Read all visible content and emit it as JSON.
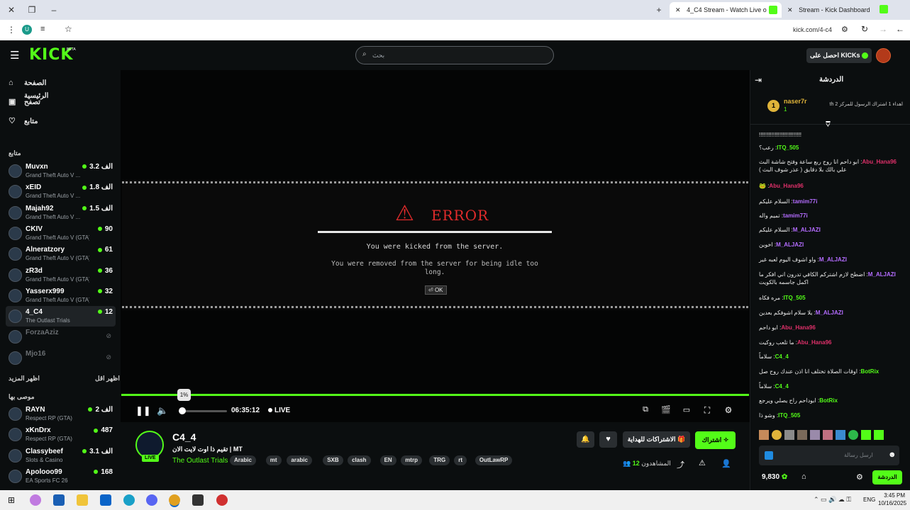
{
  "browser": {
    "tabs": [
      {
        "title": "4_C4 Stream - Watch Live o",
        "active": true
      },
      {
        "title": "Stream - Kick Dashboard",
        "active": false
      }
    ],
    "url": "kick.com/4-c4"
  },
  "header": {
    "logo": "KICK",
    "logo_sup": "BETA",
    "search_placeholder": "بحث",
    "get_kicks": "احصل على KICKs"
  },
  "sidebar": {
    "nav": [
      {
        "label": "الصفحة الرئيسية",
        "icon": "home-icon"
      },
      {
        "label": "تصفح",
        "icon": "browse-icon"
      },
      {
        "label": "متابع",
        "icon": "heart-icon"
      }
    ],
    "following_title": "متابع",
    "following": [
      {
        "name": "Muvxn",
        "game": "Grand Theft Auto V ...",
        "viewers": "3.2 الف",
        "live": true
      },
      {
        "name": "xEID",
        "game": "Grand Theft Auto V ...",
        "viewers": "1.8 الف",
        "live": true
      },
      {
        "name": "Majah92",
        "game": "Grand Theft Auto V ...",
        "viewers": "1.5 الف",
        "live": true
      },
      {
        "name": "CKIV",
        "game": "Grand Theft Auto V (GTA)",
        "viewers": "90",
        "live": true
      },
      {
        "name": "Alneratzory",
        "game": "Grand Theft Auto V (GTA)",
        "viewers": "61",
        "live": true
      },
      {
        "name": "zR3d",
        "game": "Grand Theft Auto V (GTA)",
        "viewers": "36",
        "live": true
      },
      {
        "name": "Yasserx999",
        "game": "Grand Theft Auto V (GTA)",
        "viewers": "32",
        "live": true
      },
      {
        "name": "4_C4",
        "game": "The Outlast Trials",
        "viewers": "12",
        "live": true,
        "selected": true
      },
      {
        "name": "ForzaAziz",
        "game": "",
        "viewers": "",
        "live": false
      },
      {
        "name": "Mjo16",
        "game": "",
        "viewers": "",
        "live": false
      }
    ],
    "show_more": "اظهر المزيد",
    "show_less": "اظهر اقل",
    "recommended_title": "موصى بها",
    "recommended": [
      {
        "name": "RAYN",
        "game": "Respect RP (GTA)",
        "viewers": "2 الف",
        "live": true
      },
      {
        "name": "xKnDrx",
        "game": "Respect RP (GTA)",
        "viewers": "487",
        "live": true
      },
      {
        "name": "Classybeef",
        "game": "Slots & Casino",
        "viewers": "3.1 الف",
        "live": true
      },
      {
        "name": "Apolooo99",
        "game": "EA Sports FC 26",
        "viewers": "168",
        "live": true
      }
    ]
  },
  "player": {
    "error_title": "ERROR",
    "error_line1": "You were kicked from the server.",
    "error_line2": "You were removed from the server for being idle too long.",
    "ok_label": "OK",
    "volume_tooltip": "1%",
    "volume_level": 0.01,
    "time": "06:35:12",
    "live_label": "LIVE",
    "colors": {
      "accent": "#53fc18",
      "error": "#e02b2b"
    }
  },
  "stream": {
    "channel": "C4_4",
    "title": "MT | تقيم ذا اوت لايت الان",
    "category": "The Outlast Trials",
    "tags": [
      "Arabic",
      "mt",
      "arabic",
      "SXB",
      "clash",
      "EN",
      "mtrp",
      "TRG",
      "rt",
      "OutLawRP"
    ],
    "subscribe": "اشتراك",
    "gift_subs": "الاشتراكات للهداية",
    "viewers_label": "المشاهدون",
    "viewers": "12",
    "live_badge": "LIVE"
  },
  "chat": {
    "title": "الدردشة",
    "pinned_user": "naser7r",
    "pinned_count": "1",
    "pinned_text": "اهداء 1 اشتراك الرسول للمركز 2 th",
    "messages": [
      {
        "user": "",
        "text": "!!!!!!!!!!!!!!!!!!!!!!!!!!!",
        "color": "#e8e8e8"
      },
      {
        "user": "ITQ_505",
        "text": "رعب؟",
        "color": "#53fc18"
      },
      {
        "user": "Abu_Hana96",
        "text": "ابو داحم انا روح ربع ساعة وفتح شاشة البث علي بالك بلا دقايق ( عذر شوف البث )",
        "color": "#e0306a"
      },
      {
        "user": "Abu_Hana96",
        "text": "🐸",
        "color": "#e0306a"
      },
      {
        "user": "tamim77i",
        "text": "السلام عليكم",
        "color": "#b46cff"
      },
      {
        "user": "tamim77i",
        "text": "تميم واله",
        "color": "#b46cff"
      },
      {
        "user": "M_ALJAZI",
        "text": "السلام عليكم",
        "color": "#b46cff"
      },
      {
        "user": "M_ALJAZI",
        "text": "اخوين",
        "color": "#b46cff"
      },
      {
        "user": "M_ALJAZI",
        "text": "واو اشوف اليوم لعبه غير",
        "color": "#b46cff"
      },
      {
        "user": "M_ALJAZI",
        "text": "اضطح لازم اشتركم الكافي تدرون اني افكر ما اكمل جاسمه بالكويت",
        "color": "#b46cff"
      },
      {
        "user": "ITQ_505",
        "text": "مره فكاه",
        "color": "#53fc18"
      },
      {
        "user": "M_ALJAZI",
        "text": "يلا سلام اشوفكم بعدين",
        "color": "#b46cff"
      },
      {
        "user": "Abu_Hana96",
        "text": "ابو داحم",
        "color": "#e0306a"
      },
      {
        "user": "Abu_Hana96",
        "text": "ما تلعب روكيت",
        "color": "#e0306a"
      },
      {
        "user": "4_C4",
        "text": "سلاماً",
        "color": "#53fc18"
      },
      {
        "user": "BotRix",
        "text": "اوقات الصلاة تختلف انا اذن عندك روح صل",
        "color": "#53fc18"
      },
      {
        "user": "4_C4",
        "text": "سلاماً",
        "color": "#53fc18"
      },
      {
        "user": "BotRix",
        "text": "ابوداحم راح يصلي ويرجع",
        "color": "#53fc18"
      },
      {
        "user": "ITQ_505",
        "text": "وشو ذا",
        "color": "#53fc18"
      }
    ],
    "input_placeholder": "ارسل رسالة",
    "kicks_balance": "9,830",
    "send": "الدردشة"
  },
  "taskbar": {
    "lang": "ENG",
    "time": "3:45 PM",
    "date": "10/16/2025"
  }
}
